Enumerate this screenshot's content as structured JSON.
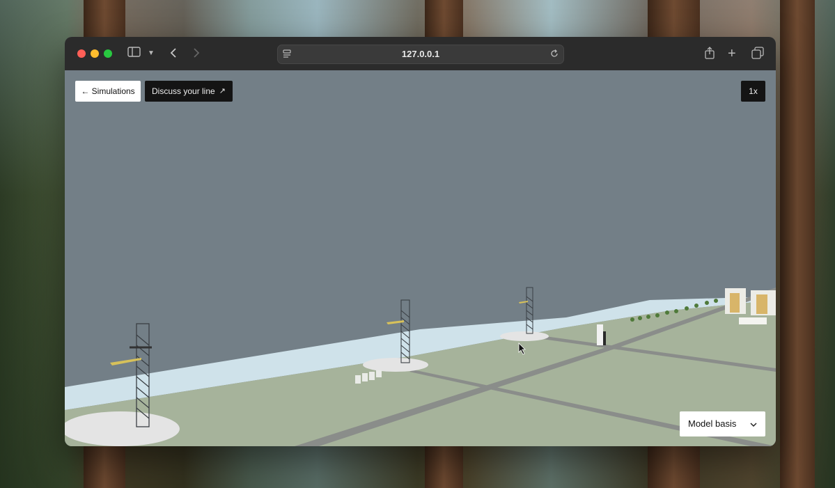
{
  "browser": {
    "url": "127.0.0.1"
  },
  "toolbar": {
    "back_label": "← Simulations",
    "discuss_label": "Discuss your line",
    "discuss_icon": "↗",
    "speed_label": "1x"
  },
  "model_select": {
    "selected": "Model basis"
  },
  "colors": {
    "sky": "#737f87",
    "ground": "#a6b39b",
    "road": "#8a8d8a",
    "water": "#cfe2ea",
    "titlebar": "#2b2b2b",
    "traffic_red": "#ff5f57",
    "traffic_yellow": "#febc2e",
    "traffic_green": "#28c840"
  }
}
